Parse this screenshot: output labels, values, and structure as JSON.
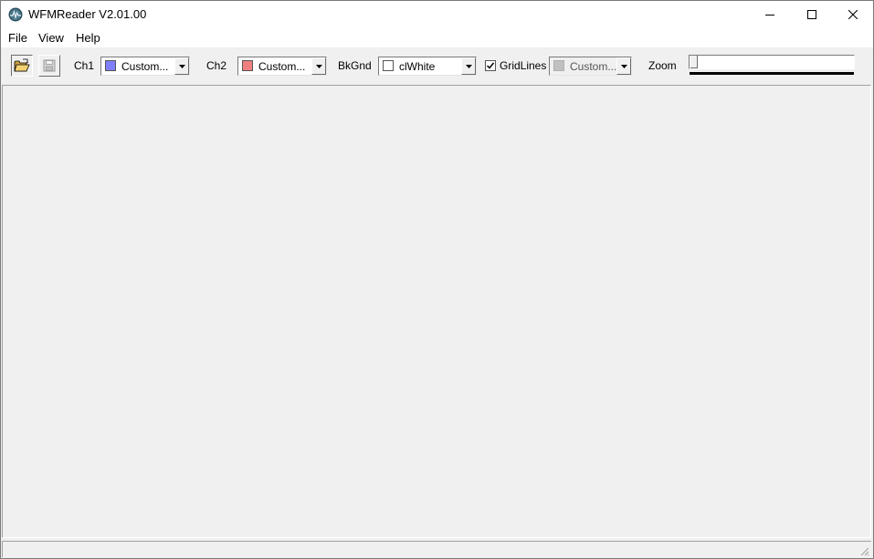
{
  "window": {
    "title": "WFMReader V2.01.00"
  },
  "menu": {
    "items": [
      "File",
      "View",
      "Help"
    ]
  },
  "toolbar": {
    "ch1": {
      "label": "Ch1",
      "value": "Custom...",
      "color": "#8080ff"
    },
    "ch2": {
      "label": "Ch2",
      "value": "Custom...",
      "color": "#f08080"
    },
    "bkgnd": {
      "label": "BkGnd",
      "value": "clWhite",
      "color": "#ffffff"
    },
    "gridlines": {
      "label": "GridLines",
      "checked": true,
      "value": "Custom...",
      "color": "#c0c0c0"
    },
    "zoom": {
      "label": "Zoom",
      "level": 0
    }
  }
}
